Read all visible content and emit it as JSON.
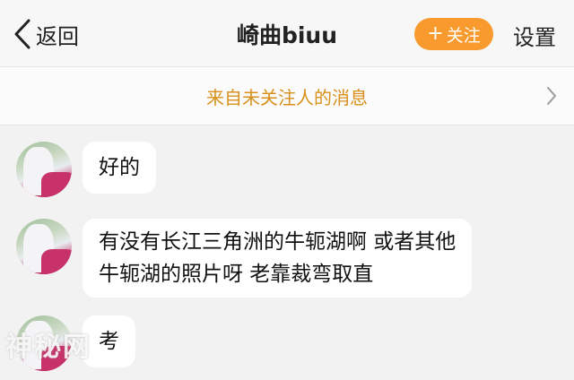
{
  "navbar": {
    "back_label": "返回",
    "title": "崎曲biuu",
    "follow_label": "关注",
    "settings_label": "设置"
  },
  "notice": {
    "text": "来自未关注人的消息"
  },
  "messages": [
    {
      "text_lines": [
        "好的"
      ]
    },
    {
      "text_lines": [
        "有没有长江三角洲的牛轭湖啊 或者其他",
        "牛轭湖的照片呀 老靠裁弯取直"
      ]
    },
    {
      "text_lines": [
        "考"
      ]
    }
  ],
  "watermark": "神秘网",
  "colors": {
    "accent_orange": "#f89a2e",
    "notice_text": "#d8901a",
    "background": "#f2f2f2",
    "bubble": "#ffffff"
  },
  "icons": {
    "back": "chevron-left-icon",
    "follow": "plus-icon",
    "notice": "chevron-right-icon"
  }
}
